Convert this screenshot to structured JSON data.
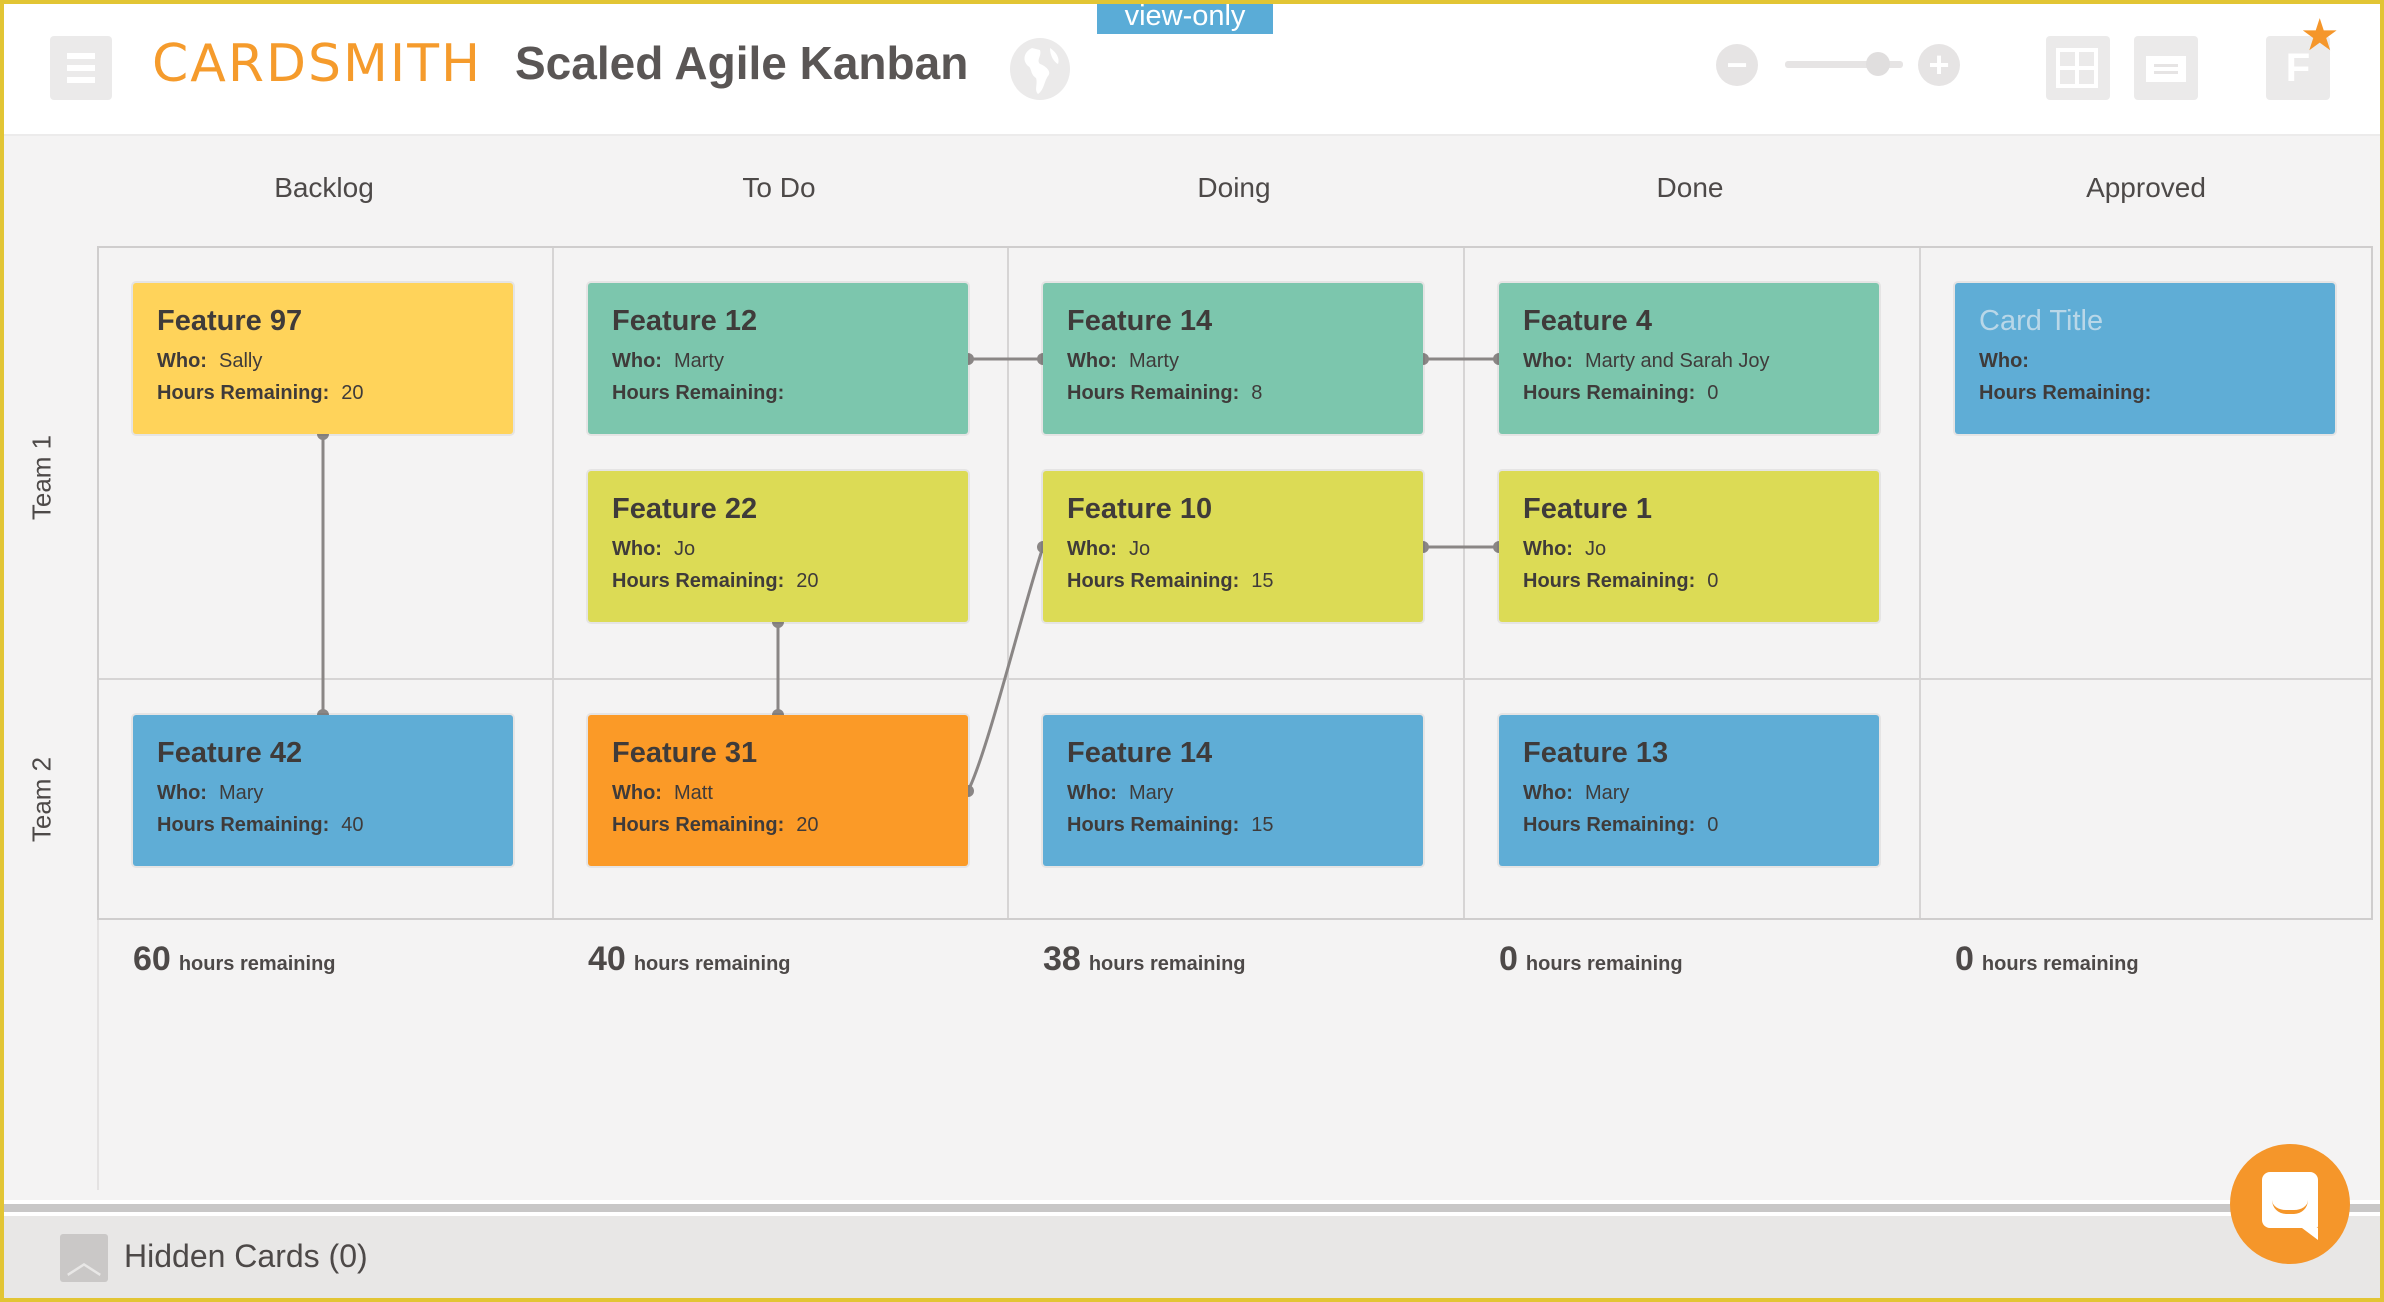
{
  "header": {
    "logo": "CARDSMITH",
    "title": "Scaled Agile Kanban",
    "mode_badge": "view-only",
    "zoom_minus": "−",
    "zoom_plus": "+",
    "zoom_level_fraction": 0.79,
    "user_initial": "F",
    "star": "★",
    "icons": [
      "menu-icon",
      "globe-icon",
      "zoom-out-icon",
      "zoom-in-icon",
      "grid-view-icon",
      "card-view-icon",
      "user-avatar",
      "star-icon"
    ]
  },
  "board": {
    "columns": [
      "Backlog",
      "To Do",
      "Doing",
      "Done",
      "Approved"
    ],
    "rows": [
      "Team 1",
      "Team 2"
    ],
    "field_labels": {
      "who": "Who:",
      "hours": "Hours Remaining:"
    },
    "colors": {
      "yellow": "#ffd35a",
      "teal": "#7cc6ad",
      "lime": "#dcdb55",
      "blue": "#5fadd6",
      "orange": "#fb9a27"
    },
    "cards": [
      {
        "id": "f97",
        "title": "Feature 97",
        "who": "Sally",
        "hours": "20",
        "color": "yellow",
        "col": 0,
        "row": 0,
        "slot": 0
      },
      {
        "id": "f12",
        "title": "Feature 12",
        "who": "Marty",
        "hours": "",
        "color": "teal",
        "col": 1,
        "row": 0,
        "slot": 0
      },
      {
        "id": "f22",
        "title": "Feature 22",
        "who": "Jo",
        "hours": "20",
        "color": "lime",
        "col": 1,
        "row": 0,
        "slot": 1
      },
      {
        "id": "f14a",
        "title": "Feature 14",
        "who": "Marty",
        "hours": "8",
        "color": "teal",
        "col": 2,
        "row": 0,
        "slot": 0
      },
      {
        "id": "f10",
        "title": "Feature 10",
        "who": "Jo",
        "hours": "15",
        "color": "lime",
        "col": 2,
        "row": 0,
        "slot": 1
      },
      {
        "id": "f4",
        "title": "Feature 4",
        "who": "Marty and Sarah Joy",
        "hours": "0",
        "color": "teal",
        "col": 3,
        "row": 0,
        "slot": 0
      },
      {
        "id": "f1",
        "title": "Feature 1",
        "who": "Jo",
        "hours": "0",
        "color": "lime",
        "col": 3,
        "row": 0,
        "slot": 1
      },
      {
        "id": "ct",
        "title": "Card Title",
        "who": "",
        "hours": "",
        "color": "blue",
        "col": 4,
        "row": 0,
        "slot": 0,
        "placeholder": true
      },
      {
        "id": "f42",
        "title": "Feature 42",
        "who": "Mary",
        "hours": "40",
        "color": "blue",
        "col": 0,
        "row": 1,
        "slot": 0
      },
      {
        "id": "f31",
        "title": "Feature 31",
        "who": "Matt",
        "hours": "20",
        "color": "orange",
        "col": 1,
        "row": 1,
        "slot": 0
      },
      {
        "id": "f14b",
        "title": "Feature 14",
        "who": "Mary",
        "hours": "15",
        "color": "blue",
        "col": 2,
        "row": 1,
        "slot": 0
      },
      {
        "id": "f13",
        "title": "Feature 13",
        "who": "Mary",
        "hours": "0",
        "color": "blue",
        "col": 3,
        "row": 1,
        "slot": 0
      }
    ],
    "links": [
      {
        "from": "f97",
        "to": "f42",
        "type": "vertical"
      },
      {
        "from": "f22",
        "to": "f31",
        "type": "vertical"
      },
      {
        "from": "f12",
        "to": "f14a",
        "type": "horizontal"
      },
      {
        "from": "f14a",
        "to": "f4",
        "type": "horizontal"
      },
      {
        "from": "f10",
        "to": "f1",
        "type": "horizontal"
      },
      {
        "from": "f31",
        "to": "f10",
        "type": "curve"
      }
    ],
    "totals": [
      {
        "value": "60",
        "label": "hours remaining"
      },
      {
        "value": "40",
        "label": "hours remaining"
      },
      {
        "value": "38",
        "label": "hours remaining"
      },
      {
        "value": "0",
        "label": "hours remaining"
      },
      {
        "value": "0",
        "label": "hours remaining"
      }
    ]
  },
  "footer": {
    "hidden_cards_label": "Hidden Cards (0)",
    "toggle_glyph": "^"
  }
}
